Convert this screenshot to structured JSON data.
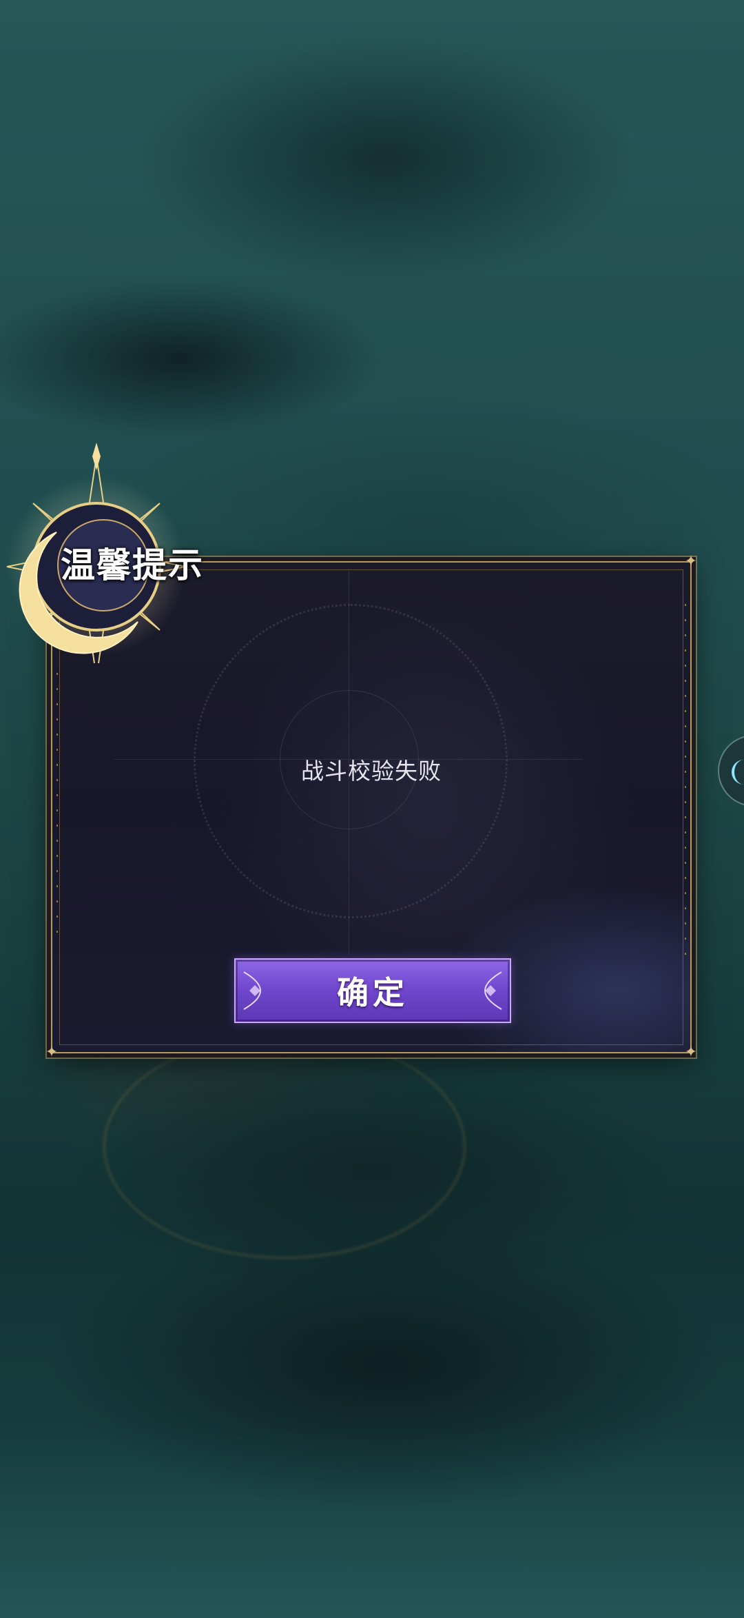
{
  "dialog": {
    "title": "温馨提示",
    "message": "战斗校验失败",
    "confirm_label": "确定"
  },
  "icons": {
    "title_emblem": "crescent-moon-sun-emblem-icon",
    "side_handle": "side-panel-handle-icon",
    "corner_ornament": "diamond-ornament-icon"
  },
  "colors": {
    "accent_gold": "#b89a5e",
    "button_purple": "#6f46cc",
    "dialog_background": "#1a1929",
    "background_teal": "#275a5c"
  }
}
